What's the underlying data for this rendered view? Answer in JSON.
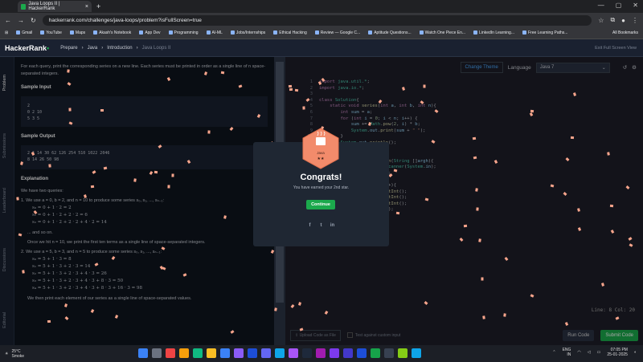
{
  "browser": {
    "tab_title": "Java Loops II | HackerRank",
    "url": "hackerrank.com/challenges/java-loops/problem?isFullScreen=true",
    "bookmarks": [
      "Gmail",
      "YouTube",
      "Maps",
      "Akash's Notebook",
      "App Dev",
      "Programming",
      "AI-ML",
      "Jobs/Internships",
      "Ethical Hacking",
      "Review — Google C...",
      "Aptitude Questions...",
      "Watch One Piece En...",
      "LinkedIn Learning...",
      "Free Learning Paths..."
    ],
    "all_bookmarks": "All Bookmarks"
  },
  "header": {
    "logo": "HackerRank",
    "crumbs": [
      "Prepare",
      "Java",
      "Introduction",
      "Java Loops II"
    ],
    "exit_fullscreen": "Exit Full Screen View"
  },
  "sidebar_tabs": [
    "Problem",
    "Submissions",
    "Leaderboard",
    "Discussions",
    "Editorial"
  ],
  "problem": {
    "intro": "For each query, print the corresponding series on a new line. Each series must be printed in order as a single line of n space-separated integers.",
    "sample_input_heading": "Sample Input",
    "sample_input": [
      "2",
      "0 2 10",
      "5 3 5"
    ],
    "sample_output_heading": "Sample Output",
    "sample_output": [
      "2 6 14 30 62 126 254 510 1022 2046",
      "8 14 26 50 98"
    ],
    "explanation_heading": "Explanation",
    "explanation_intro": "We have two queries:",
    "q1": "1. We use a = 0, b = 2, and n = 10 to produce some series s₀, s₁, ..., sₙ₋₁:",
    "q1_terms": [
      "s₀ = 0 + 1 · 2 = 2",
      "s₁ = 0 + 1 · 2 + 2 · 2 = 6",
      "s₂ = 0 + 1 · 2 + 2 · 2 + 4 · 2 = 14"
    ],
    "q1_more": "... and so on.",
    "q1_note": "Once we hit n = 10, we print the first ten terms as a single line of space-separated integers.",
    "q2": "2. We use a = 5, b = 3, and n = 5 to produce some series s₀, s₁, ..., sₙ₋₁:",
    "q2_terms": [
      "s₀ = 5 + 1 · 3 = 8",
      "s₁ = 5 + 1 · 3 + 2 · 3 = 14",
      "s₂ = 5 + 1 · 3 + 2 · 3 + 4 · 3 = 26",
      "s₃ = 5 + 1 · 3 + 2 · 3 + 4 · 3 + 8 · 3 = 50",
      "s₄ = 5 + 1 · 3 + 2 · 3 + 4 · 3 + 8 · 3 + 16 · 3 = 98"
    ],
    "closing": "We then print each element of our series as a single line of space-separated values."
  },
  "editor": {
    "change_theme": "Change Theme",
    "language_label": "Language",
    "language_value": "Java 7",
    "status": "Line: 8 Col: 20",
    "upload": "Upload Code as File",
    "custom_input": "Test against custom input",
    "run": "Run Code",
    "submit": "Submit Code"
  },
  "modal": {
    "badge_text": "Java",
    "badge_stars": "★★",
    "title": "Congrats!",
    "message": "You have earned your 2nd star.",
    "button": "Continue"
  },
  "taskbar": {
    "temp": "25°C",
    "weather": "Smoke",
    "lang": "ENG",
    "region": "IN",
    "time": "07:05 PM",
    "date": "25-01-2025"
  }
}
